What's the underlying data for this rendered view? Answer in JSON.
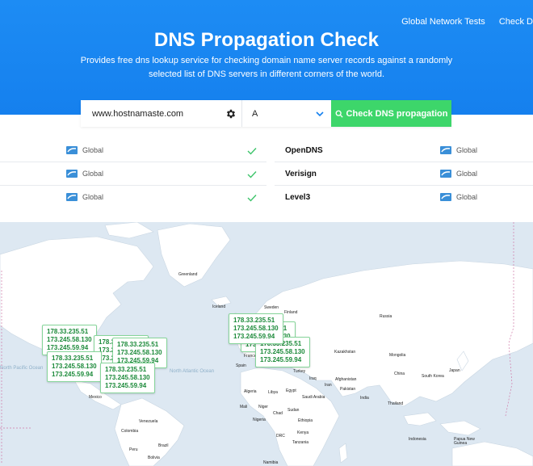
{
  "nav": {
    "links": [
      "Global Network Tests",
      "Check D"
    ]
  },
  "hero": {
    "title": "DNS Propagation Check",
    "subtitle": "Provides free dns lookup service for checking domain name server records against a randomly selected list of DNS servers in different corners of the world."
  },
  "search": {
    "domain_value": "www.hostnamaste.com",
    "record_type": "A",
    "button_label": "Check DNS propagation"
  },
  "results": {
    "left": [
      {
        "location": "Global",
        "status": "ok"
      },
      {
        "location": "Global",
        "status": "ok"
      },
      {
        "location": "Global",
        "status": "ok"
      }
    ],
    "right": [
      {
        "name": "OpenDNS",
        "location": "Global"
      },
      {
        "name": "Verisign",
        "location": "Global"
      },
      {
        "name": "Level3",
        "location": "Global"
      }
    ]
  },
  "map": {
    "country_labels": [
      "Greenland",
      "Iceland",
      "Sweden",
      "Finland",
      "Russia",
      "Kazakhstan",
      "Mongolia",
      "China",
      "South Korea",
      "Japan",
      "Turkey",
      "Spain",
      "France",
      "Afghanistan",
      "Pakistan",
      "India",
      "Iran",
      "Iraq",
      "Saudi Arabia",
      "Egypt",
      "Libya",
      "Algeria",
      "Mali",
      "Niger",
      "Chad",
      "Nigeria",
      "Sudan",
      "Ethiopia",
      "Kenya",
      "DRC",
      "Tanzania",
      "Thailand",
      "Mexico",
      "Venezuela",
      "Colombia",
      "Peru",
      "Brazil",
      "Bolivia",
      "Indonesia",
      "Papua New Guinea",
      "Namibia"
    ],
    "ocean_labels": [
      "North Atlantic Ocean",
      "North Pacific Ocean"
    ],
    "ip_groups": [
      {
        "ips": [
          "178.33.235.51",
          "173.245.58.130",
          "173.245.59.94"
        ]
      },
      {
        "ips": [
          "178.33.235.51",
          "173.245.58.130",
          "173.245.59.94"
        ]
      },
      {
        "ips": [
          "178.33.235.51",
          "173.245.58.130",
          "173.245.59.94"
        ]
      },
      {
        "ips": [
          "178.33.235.51",
          "173.245.58.130",
          "173.245.59.94"
        ]
      },
      {
        "ips": [
          "178.33.235.51",
          "173.245.58.130",
          "173.245.59.94"
        ]
      },
      {
        "ips": [
          "178.33.235.51",
          "173.245.58.130",
          "173.245.59.94"
        ]
      },
      {
        "ips": [
          "178.33.235.51",
          "173.245.58.130",
          "173.245.59.94"
        ]
      },
      {
        "ips": [
          "178.33.235.51",
          "173.245.58.130",
          "173.245.59.94"
        ]
      }
    ]
  },
  "colors": {
    "hero_blue": "#1580ee",
    "accent_green": "#3dd66a",
    "ip_text_green": "#1c8a3a",
    "map_ocean": "#dde8f2",
    "map_land": "#ffffff"
  }
}
